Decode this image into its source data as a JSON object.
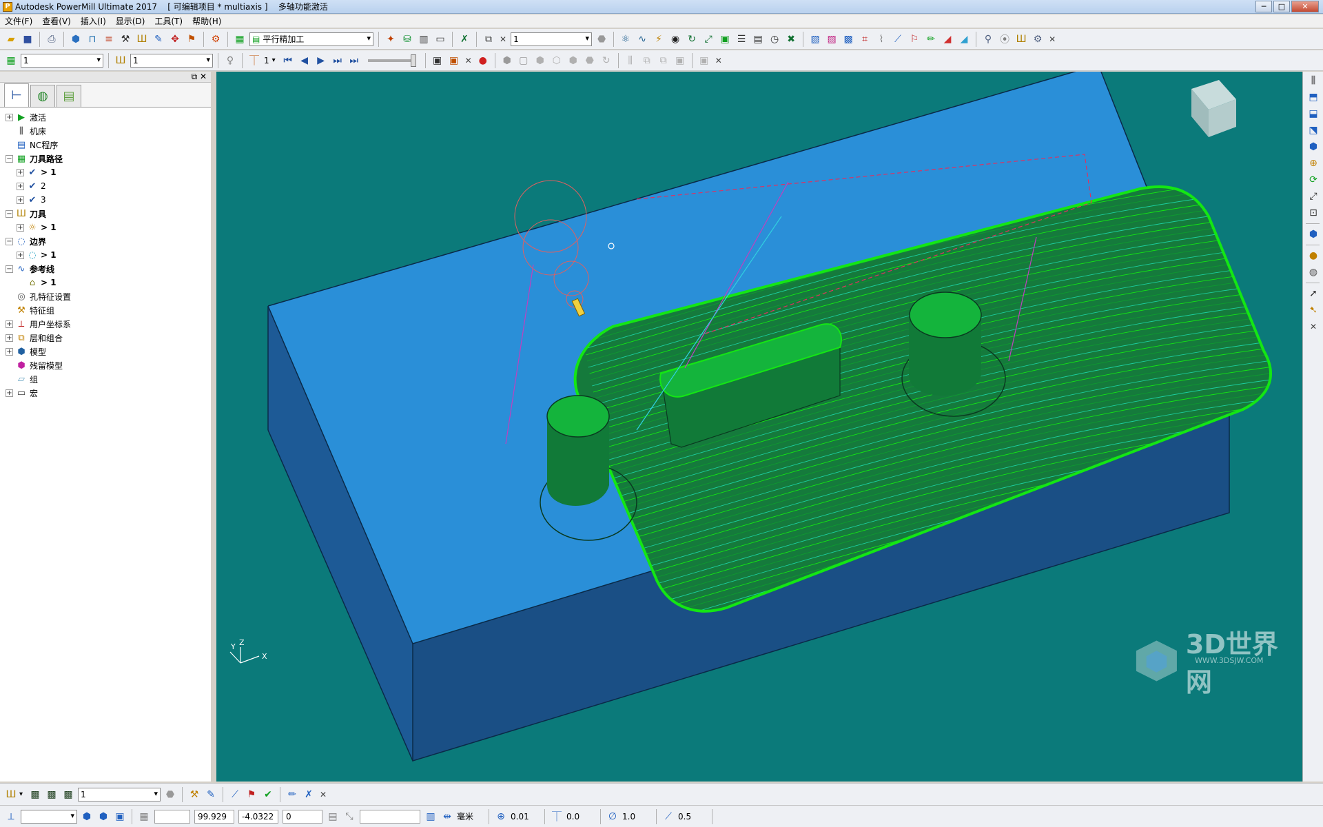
{
  "window": {
    "title": "Autodesk PowerMill Ultimate 2017    [ 可编辑项目 * multiaxis ]    多轴功能激活",
    "minimize": "─",
    "maximize": "□",
    "close": "✕"
  },
  "menu": {
    "items": [
      "文件(F)",
      "查看(V)",
      "插入(I)",
      "显示(D)",
      "工具(T)",
      "帮助(H)"
    ]
  },
  "toolbar1": {
    "strategy_value": "平行精加工",
    "workplane_value": "1"
  },
  "toolbar2": {
    "toolpath_value": "1",
    "tool_value": "1",
    "step_value": "1"
  },
  "explorer": {
    "tree": [
      {
        "label": "激活",
        "expanded": false,
        "bold": false,
        "icon": "activate-icon"
      },
      {
        "label": "机床",
        "expanded": null,
        "bold": false,
        "icon": "machine-icon"
      },
      {
        "label": "NC程序",
        "expanded": null,
        "bold": false,
        "icon": "nc-program-icon"
      },
      {
        "label": "刀具路径",
        "expanded": true,
        "bold": true,
        "icon": "toolpath-icon"
      },
      {
        "label": "> 1",
        "expanded": false,
        "bold": true,
        "icon": "toolpath-item-icon"
      },
      {
        "label": "2",
        "expanded": false,
        "bold": false,
        "icon": "toolpath-item-icon"
      },
      {
        "label": "3",
        "expanded": false,
        "bold": false,
        "icon": "toolpath-item-icon"
      },
      {
        "label": "刀具",
        "expanded": true,
        "bold": true,
        "icon": "tool-icon"
      },
      {
        "label": "> 1",
        "expanded": false,
        "bold": true,
        "icon": "tool-item-icon"
      },
      {
        "label": "边界",
        "expanded": true,
        "bold": true,
        "icon": "boundary-icon"
      },
      {
        "label": "> 1",
        "expanded": false,
        "bold": true,
        "icon": "boundary-item-icon"
      },
      {
        "label": "参考线",
        "expanded": true,
        "bold": true,
        "icon": "pattern-icon"
      },
      {
        "label": "> 1",
        "expanded": null,
        "bold": true,
        "icon": "pattern-item-icon"
      },
      {
        "label": "孔特征设置",
        "expanded": null,
        "bold": false,
        "icon": "hole-feature-icon"
      },
      {
        "label": "特征组",
        "expanded": null,
        "bold": false,
        "icon": "feature-group-icon"
      },
      {
        "label": "用户坐标系",
        "expanded": false,
        "bold": false,
        "icon": "workplane-icon"
      },
      {
        "label": "层和组合",
        "expanded": false,
        "bold": false,
        "icon": "levels-icon"
      },
      {
        "label": "模型",
        "expanded": false,
        "bold": false,
        "icon": "model-icon"
      },
      {
        "label": "残留模型",
        "expanded": null,
        "bold": false,
        "icon": "stock-model-icon"
      },
      {
        "label": "组",
        "expanded": null,
        "bold": false,
        "icon": "group-icon"
      },
      {
        "label": "宏",
        "expanded": false,
        "bold": false,
        "icon": "macro-icon"
      }
    ]
  },
  "viewport": {
    "axis_labels": {
      "x": "X",
      "y": "Y",
      "z": "Z"
    },
    "background": "#0b7a7a",
    "block_top": "#2a8fd8",
    "block_side_front": "#1a4f85",
    "block_side_left": "#1d5a96",
    "toolpath_color": "#14e614"
  },
  "bottom": {
    "tool_value": "1",
    "x": "99.929",
    "y": "-4.0322",
    "z": "0",
    "units": "毫米",
    "tolerance": "0.01",
    "thickness": "0.0",
    "diameter": "1.0",
    "stepover": "0.5"
  },
  "watermark": {
    "text": "3D世界网",
    "url": "WWW.3DSJW.COM"
  }
}
